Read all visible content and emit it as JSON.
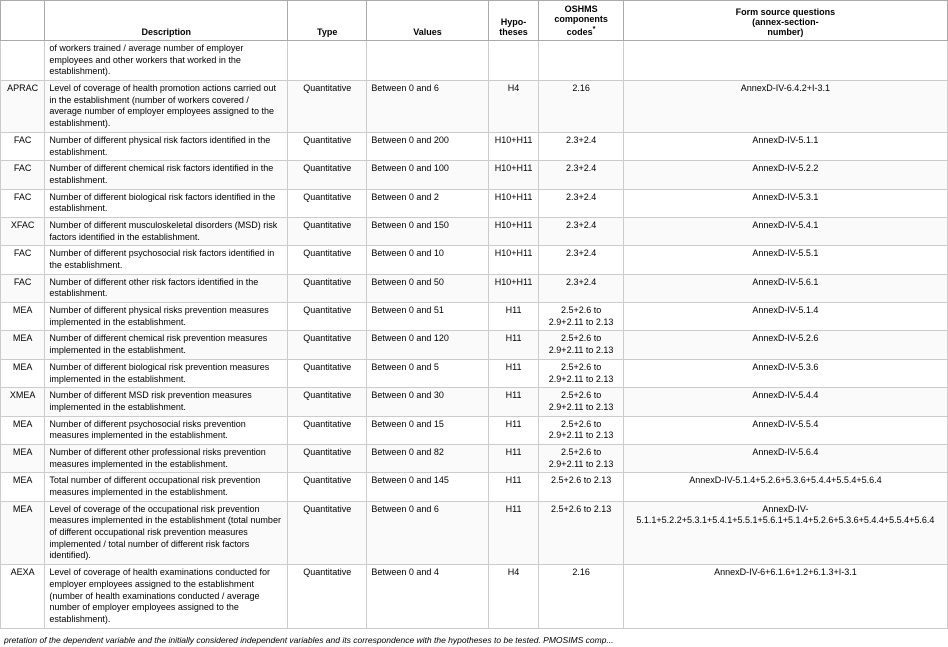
{
  "table": {
    "headers": {
      "abbr": "",
      "description": "Description",
      "type": "Type",
      "values": "Values",
      "hypotheses": "Hypo-theses",
      "oshms": "OSHMS components codes*",
      "form": "Form source questions (annex-section-number)"
    },
    "rows": [
      {
        "abbr": "",
        "description": "of workers trained / average number of employer employees and other workers that worked in the establishment).",
        "type": "",
        "values": "",
        "hypotheses": "",
        "oshms": "",
        "form": ""
      },
      {
        "abbr": "APRAC",
        "description": "Level of coverage of health promotion actions carried out in the establishment (number of workers covered / average number of employer employees assigned to the establishment).",
        "type": "Quantitative",
        "values": "Between 0 and 6",
        "hypotheses": "H4",
        "oshms": "2.16",
        "form": "AnnexD-IV-6.4.2+I-3.1"
      },
      {
        "abbr": "FAC",
        "description": "Number of different physical risk factors identified in the establishment.",
        "type": "Quantitative",
        "values": "Between 0 and 200",
        "hypotheses": "H10+H11",
        "oshms": "2.3+2.4",
        "form": "AnnexD-IV-5.1.1"
      },
      {
        "abbr": "FAC",
        "description": "Number of different chemical risk factors identified in the establishment.",
        "type": "Quantitative",
        "values": "Between 0 and 100",
        "hypotheses": "H10+H11",
        "oshms": "2.3+2.4",
        "form": "AnnexD-IV-5.2.2"
      },
      {
        "abbr": "FAC",
        "description": "Number of different biological risk factors identified in the establishment.",
        "type": "Quantitative",
        "values": "Between 0 and 2",
        "hypotheses": "H10+H11",
        "oshms": "2.3+2.4",
        "form": "AnnexD-IV-5.3.1"
      },
      {
        "abbr": "XFAC",
        "description": "Number of different musculoskeletal disorders (MSD) risk factors identified in the establishment.",
        "type": "Quantitative",
        "values": "Between 0 and 150",
        "hypotheses": "H10+H11",
        "oshms": "2.3+2.4",
        "form": "AnnexD-IV-5.4.1"
      },
      {
        "abbr": "FAC",
        "description": "Number of different psychosocial risk factors identified in the establishment.",
        "type": "Quantitative",
        "values": "Between 0 and 10",
        "hypotheses": "H10+H11",
        "oshms": "2.3+2.4",
        "form": "AnnexD-IV-5.5.1"
      },
      {
        "abbr": "FAC",
        "description": "Number of different other risk factors identified in the establishment.",
        "type": "Quantitative",
        "values": "Between 0 and 50",
        "hypotheses": "H10+H11",
        "oshms": "2.3+2.4",
        "form": "AnnexD-IV-5.6.1"
      },
      {
        "abbr": "MEA",
        "description": "Number of different physical risks prevention measures implemented in the establishment.",
        "type": "Quantitative",
        "values": "Between 0 and 51",
        "hypotheses": "H11",
        "oshms": "2.5+2.6 to 2.9+2.11 to 2.13",
        "form": "AnnexD-IV-5.1.4"
      },
      {
        "abbr": "MEA",
        "description": "Number of different chemical risk prevention measures implemented in the establishment.",
        "type": "Quantitative",
        "values": "Between 0 and 120",
        "hypotheses": "H11",
        "oshms": "2.5+2.6 to 2.9+2.11 to 2.13",
        "form": "AnnexD-IV-5.2.6"
      },
      {
        "abbr": "MEA",
        "description": "Number of different biological risk prevention measures implemented in the establishment.",
        "type": "Quantitative",
        "values": "Between 0 and 5",
        "hypotheses": "H11",
        "oshms": "2.5+2.6 to 2.9+2.11 to 2.13",
        "form": "AnnexD-IV-5.3.6"
      },
      {
        "abbr": "XMEA",
        "description": "Number of different MSD risk prevention measures implemented in the establishment.",
        "type": "Quantitative",
        "values": "Between 0 and 30",
        "hypotheses": "H11",
        "oshms": "2.5+2.6 to 2.9+2.11 to 2.13",
        "form": "AnnexD-IV-5.4.4"
      },
      {
        "abbr": "MEA",
        "description": "Number of different psychosocial risks prevention measures implemented in the establishment.",
        "type": "Quantitative",
        "values": "Between 0 and 15",
        "hypotheses": "H11",
        "oshms": "2.5+2.6 to 2.9+2.11 to 2.13",
        "form": "AnnexD-IV-5.5.4"
      },
      {
        "abbr": "MEA",
        "description": "Number of different other professional risks prevention measures implemented in the establishment.",
        "type": "Quantitative",
        "values": "Between 0 and 82",
        "hypotheses": "H11",
        "oshms": "2.5+2.6 to 2.9+2.11 to 2.13",
        "form": "AnnexD-IV-5.6.4"
      },
      {
        "abbr": "MEA",
        "description": "Total number of different occupational risk prevention measures implemented in the establishment.",
        "type": "Quantitative",
        "values": "Between 0 and 145",
        "hypotheses": "H11",
        "oshms": "2.5+2.6 to 2.13",
        "form": "AnnexD-IV-5.1.4+5.2.6+5.3.6+5.4.4+5.5.4+5.6.4"
      },
      {
        "abbr": "MEA",
        "description": "Level of coverage of the occupational risk prevention measures implemented in the establishment (total number of different occupational risk prevention measures implemented / total number of different risk factors identified).",
        "type": "Quantitative",
        "values": "Between 0 and 6",
        "hypotheses": "H11",
        "oshms": "2.5+2.6 to 2.13",
        "form": "AnnexD-IV-5.1.1+5.2.2+5.3.1+5.4.1+5.5.1+5.6.1+5.1.4+5.2.6+5.3.6+5.4.4+5.5.4+5.6.4"
      },
      {
        "abbr": "AEXA",
        "description": "Level of coverage of health examinations conducted for employer employees assigned to the establishment (number of health examinations conducted / average number of employer employees assigned to the establishment).",
        "type": "Quantitative",
        "values": "Between 0 and 4",
        "hypotheses": "H4",
        "oshms": "2.16",
        "form": "AnnexD-IV-6+6.1.6+1.2+6.1.3+I-3.1"
      }
    ],
    "footnote": "pretation of the dependent variable and the initially considered independent variables and its correspondence with the hypotheses to be tested. PMOSIMS comp..."
  }
}
